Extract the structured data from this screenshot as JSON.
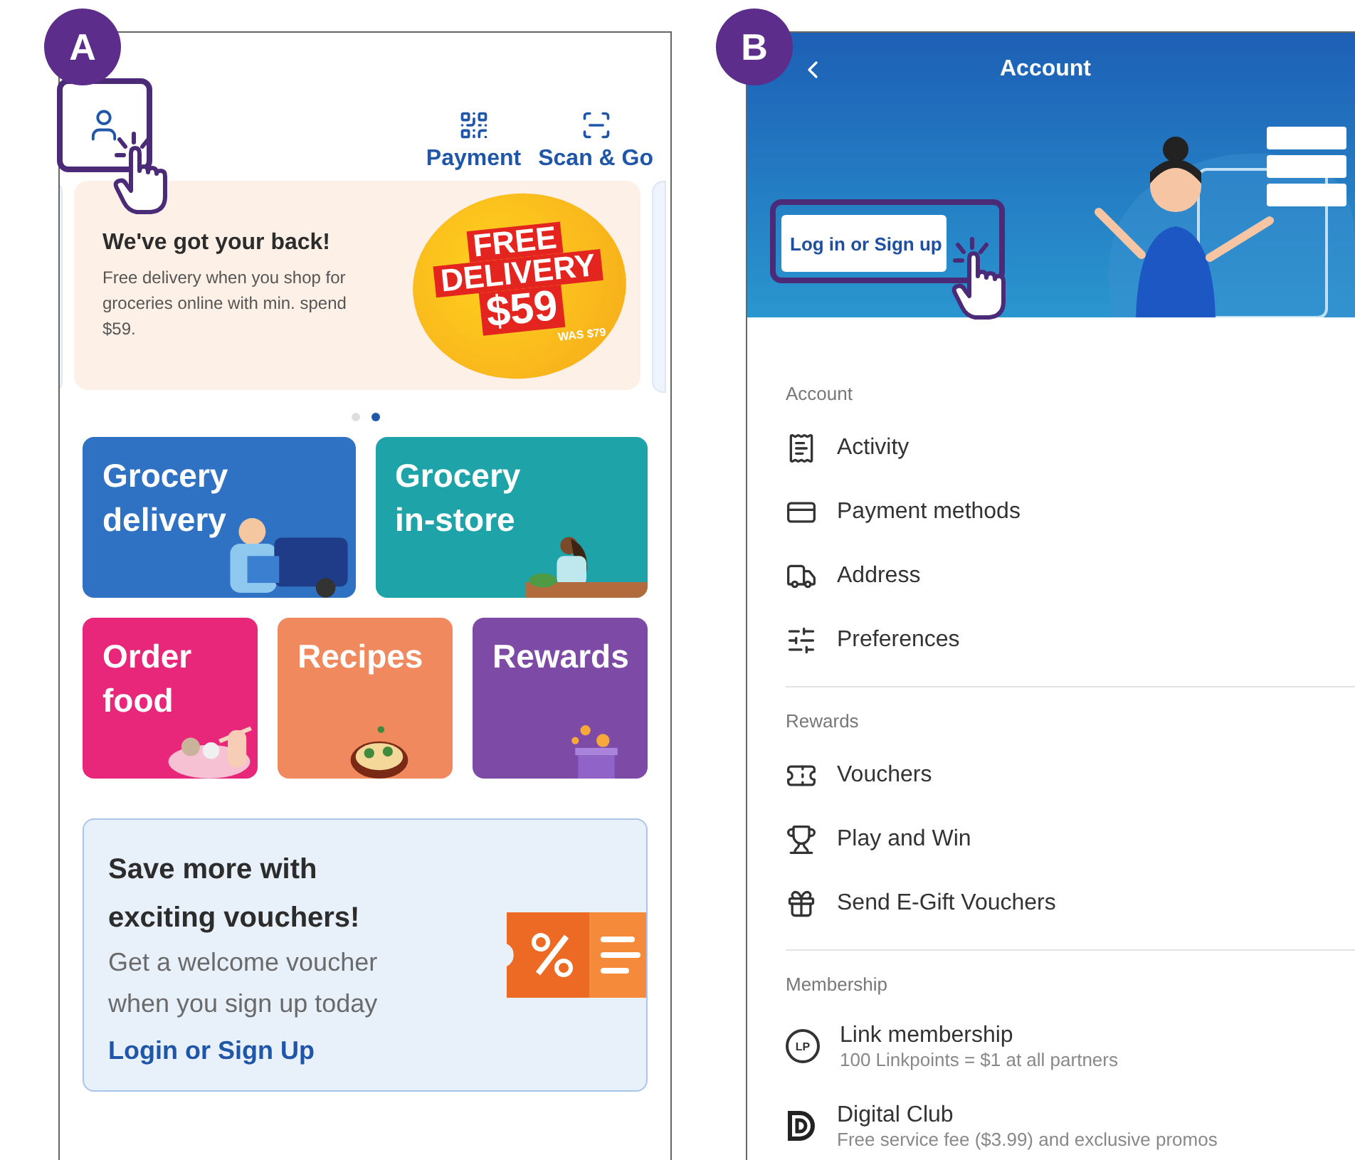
{
  "panel_a": {
    "badge": "A",
    "header_actions": [
      {
        "label": "Payment"
      },
      {
        "label": "Scan & Go"
      }
    ],
    "banner": {
      "title": "We've got your back!",
      "text": "Free delivery when you shop for groceries online with min. spend $59.",
      "promo": [
        "FREE",
        "DELIVERY",
        "$59"
      ],
      "promo_note": "WAS $79"
    },
    "carousel_dots": [
      {
        "selected": false
      },
      {
        "selected": true
      }
    ],
    "tile_rows": [
      [
        {
          "label": "Grocery delivery",
          "color": "#2f72c4"
        },
        {
          "label": "Grocery in-store",
          "color": "#1ea3a8"
        }
      ],
      [
        {
          "label": "Order food",
          "color": "#e8277a"
        },
        {
          "label": "Recipes",
          "color": "#f08a5e"
        },
        {
          "label": "Rewards",
          "color": "#7d4aa6"
        }
      ]
    ],
    "voucher_card": {
      "title": "Save more with exciting vouchers!",
      "text": "Get a welcome voucher when you sign up today",
      "link": "Login or Sign Up"
    }
  },
  "panel_b": {
    "badge": "B",
    "title": "Account",
    "login_button": "Log in or Sign up",
    "sections": [
      {
        "heading": "Account",
        "items": [
          {
            "label": "Activity"
          },
          {
            "label": "Payment methods"
          },
          {
            "label": "Address"
          },
          {
            "label": "Preferences"
          }
        ]
      },
      {
        "heading": "Rewards",
        "items": [
          {
            "label": "Vouchers"
          },
          {
            "label": "Play and Win"
          },
          {
            "label": "Send E-Gift Vouchers"
          }
        ]
      },
      {
        "heading": "Membership",
        "items": [
          {
            "label": "Link membership",
            "subtitle": "100 Linkpoints = $1 at all partners",
            "icon_text": "LP"
          },
          {
            "label": "Digital Club",
            "subtitle": "Free service fee ($3.99) and exclusive promos"
          }
        ]
      }
    ]
  }
}
